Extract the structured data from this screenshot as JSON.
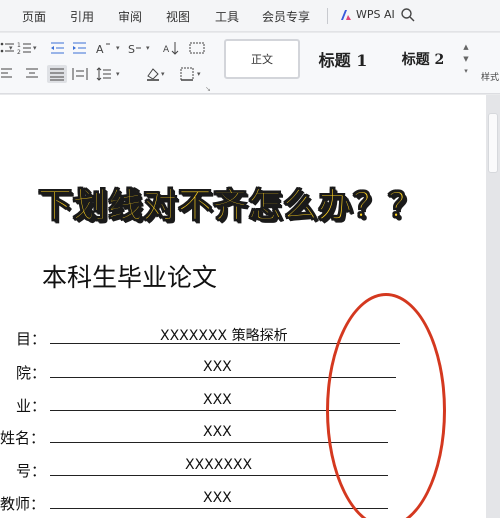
{
  "menubar": {
    "items": [
      "页面",
      "引用",
      "审阅",
      "视图",
      "工具",
      "会员专享"
    ],
    "ai_label": "WPS AI",
    "icons": {
      "ai": "wps-ai-logo-icon",
      "search": "search-icon"
    }
  },
  "ribbon": {
    "styles": {
      "normal": "正文",
      "heading1": "标题 1",
      "heading2": "标题 2",
      "more_label": "样式"
    },
    "icons": [
      "bullet-list-icon",
      "numbered-list-icon",
      "decrease-indent-icon",
      "increase-indent-icon",
      "text-direction-icon",
      "chinese-layout-icon",
      "sort-icon",
      "show-marks-icon",
      "align-left-icon",
      "align-center-icon",
      "justify-icon",
      "distribute-icon",
      "line-spacing-icon",
      "shading-icon",
      "border-icon"
    ]
  },
  "document": {
    "headline": "下划线对不齐怎么办？？",
    "title": "本科生毕业论文",
    "fields": [
      {
        "label": "目：",
        "value": "XXXXXXX 策略探析"
      },
      {
        "label": "院：",
        "value": "XXX"
      },
      {
        "label": "业：",
        "value": "XXX"
      },
      {
        "label": "姓名：",
        "value": "XXX"
      },
      {
        "label": "号：",
        "value": "XXXXXXX"
      },
      {
        "label": "教师：",
        "value": "XXX"
      }
    ]
  },
  "colors": {
    "headline_fill": "#ffd21f",
    "annotation_oval": "#d4381f",
    "wps_ai_accent": "#3b5bdb"
  }
}
